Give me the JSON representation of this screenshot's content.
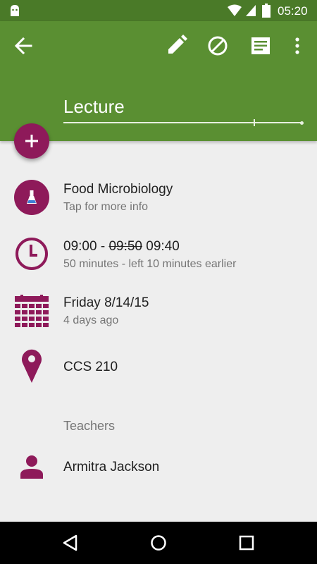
{
  "status_bar": {
    "time": "05:20",
    "icons": [
      "notification-icon",
      "wifi-icon",
      "signal-icon",
      "battery-icon"
    ]
  },
  "toolbar": {
    "back_icon": "arrow-back-icon",
    "actions": [
      "edit-icon",
      "cancel-icon",
      "notes-icon",
      "more-vert-icon"
    ],
    "title": "Lecture"
  },
  "details": {
    "subject": {
      "name": "Food Microbiology",
      "hint": "Tap for more info"
    },
    "time": {
      "start": "09:00",
      "separator": " - ",
      "original_end": "09:50",
      "new_end": "09:40",
      "note": "50 minutes - left 10 minutes earlier"
    },
    "date": {
      "value": "Friday 8/14/15",
      "relative": "4 days ago"
    },
    "location": {
      "room": "CCS 210"
    }
  },
  "teachers": {
    "header": "Teachers",
    "items": [
      {
        "name": "Armitra Jackson"
      }
    ]
  },
  "colors": {
    "primary": "#5a8f32",
    "primary_dark": "#4a7a28",
    "accent": "#8e1a5a",
    "background": "#eeeeee"
  }
}
